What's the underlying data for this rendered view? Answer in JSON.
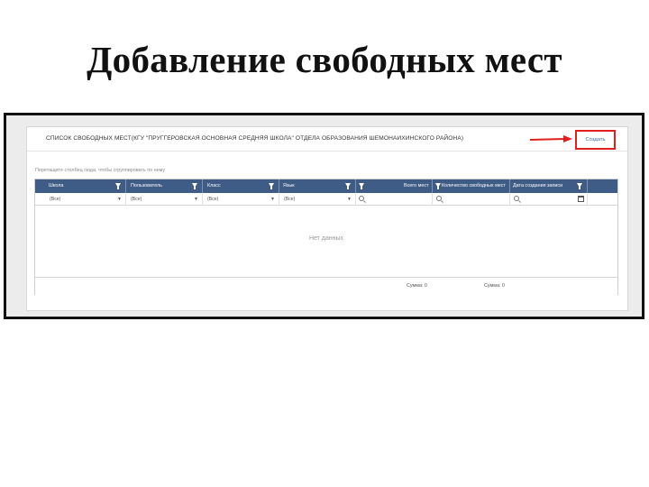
{
  "slide": {
    "title": "Добавление свободных мест"
  },
  "panel": {
    "title": "СПИСОК СВОБОДНЫХ МЕСТ(КГУ \"ПРУГГЕРОВСКАЯ ОСНОВНАЯ СРЕДНЯЯ ШКОЛА\" ОТДЕЛА ОБРАЗОВАНИЯ ШЕМОНАИХИНСКОГО РАЙОНА)",
    "create_label": "Создать",
    "group_hint": "Перетащите столбец сюда, чтобы сгруппировать по нему"
  },
  "grid": {
    "columns": [
      {
        "label": "Школа"
      },
      {
        "label": "Пользователь"
      },
      {
        "label": "Класс"
      },
      {
        "label": "Язык"
      },
      {
        "label": "Всего мест"
      },
      {
        "label": "Количество свободных мест"
      },
      {
        "label": "Дата создания записи"
      }
    ],
    "filter_value": "(Все)",
    "empty_text": "Нет данных",
    "sum_total": "Сумма: 0",
    "sum_free": "Сумма: 0"
  },
  "colors": {
    "header_bg": "#3f5c86",
    "highlight": "#e0201c",
    "link": "#3b6ea8"
  },
  "icons": [
    "filter-icon",
    "search-icon",
    "calendar-icon",
    "dropdown-caret-icon",
    "red-arrow-icon"
  ]
}
